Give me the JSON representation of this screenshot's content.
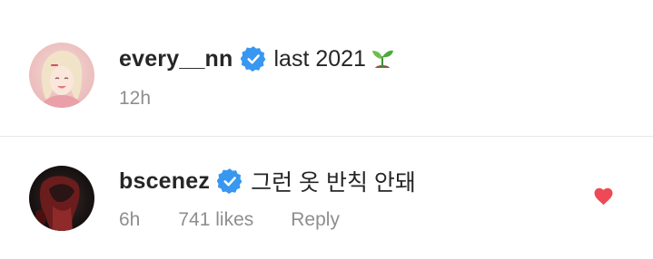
{
  "post_caption": {
    "username": "every__nn",
    "text": "last 2021",
    "emoji_icon": "seedling-icon",
    "timestamp": "12h",
    "verified": true
  },
  "comment": {
    "username": "bscenez",
    "text": "그런 옷 반칙 안돼",
    "timestamp": "6h",
    "likes": "741 likes",
    "reply_label": "Reply",
    "verified": true,
    "liked": true
  },
  "colors": {
    "verified_badge": "#3897f0",
    "like_heart": "#ed4956",
    "meta_text": "#8e8e8e",
    "primary_text": "#262626",
    "divider": "#e6e6e6"
  }
}
